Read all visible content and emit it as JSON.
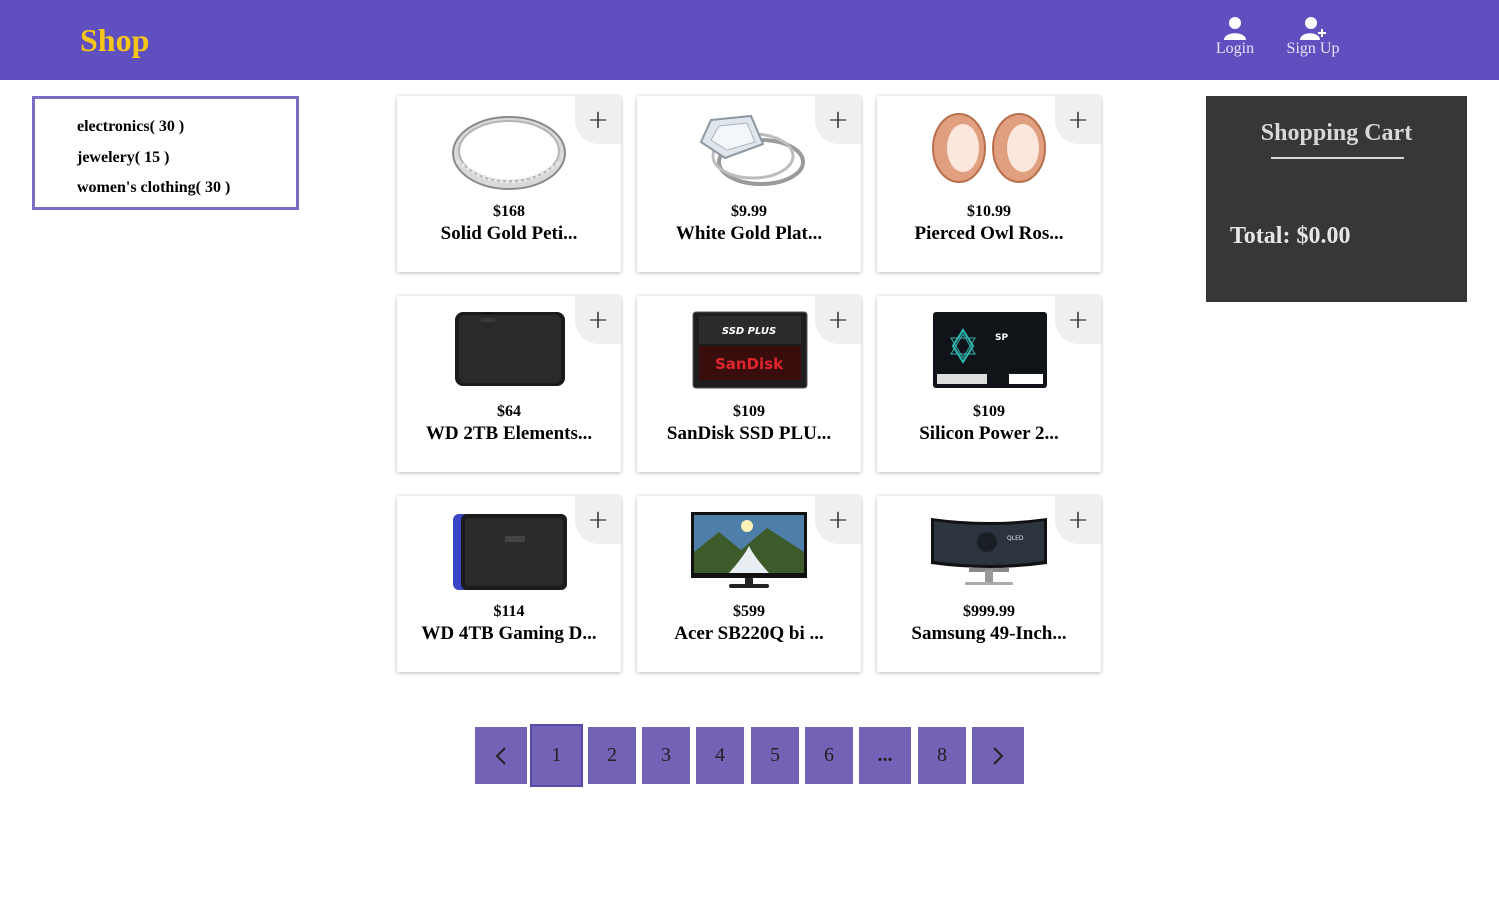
{
  "header": {
    "brand": "Shop",
    "login_label": "Login",
    "signup_label": "Sign Up"
  },
  "sidebar": {
    "categories": [
      {
        "label": "electronics( 30 )"
      },
      {
        "label": "jewelery( 15 )"
      },
      {
        "label": "women's clothing( 30 )"
      }
    ]
  },
  "products": [
    {
      "price": "$168",
      "title": "Solid Gold Peti...",
      "image": "silver-ring"
    },
    {
      "price": "$9.99",
      "title": "White Gold Plat...",
      "image": "diamond-ring-set"
    },
    {
      "price": "$10.99",
      "title": "Pierced Owl Ros...",
      "image": "rose-gold-plugs"
    },
    {
      "price": "$64",
      "title": "WD 2TB Elements...",
      "image": "black-hard-drive"
    },
    {
      "price": "$109",
      "title": "SanDisk SSD PLU...",
      "image": "sandisk-ssd"
    },
    {
      "price": "$109",
      "title": "Silicon Power 2...",
      "image": "silicon-power-ssd"
    },
    {
      "price": "$114",
      "title": "WD 4TB Gaming D...",
      "image": "gaming-drive"
    },
    {
      "price": "$599",
      "title": "Acer SB220Q bi ...",
      "image": "acer-monitor"
    },
    {
      "price": "$999.99",
      "title": "Samsung 49-Inch...",
      "image": "samsung-curved-monitor"
    }
  ],
  "cart": {
    "title": "Shopping Cart",
    "total_label": "Total: $0.00"
  },
  "pagination": {
    "prev": "<",
    "pages": [
      "1",
      "2",
      "3",
      "4",
      "5",
      "6",
      "...",
      "8"
    ],
    "current": "1",
    "next": ">"
  },
  "colors": {
    "header_bg": "#5f4fbf",
    "brand": "#f5c518",
    "pager_bg": "#7362b5",
    "cart_bg": "#373737"
  }
}
